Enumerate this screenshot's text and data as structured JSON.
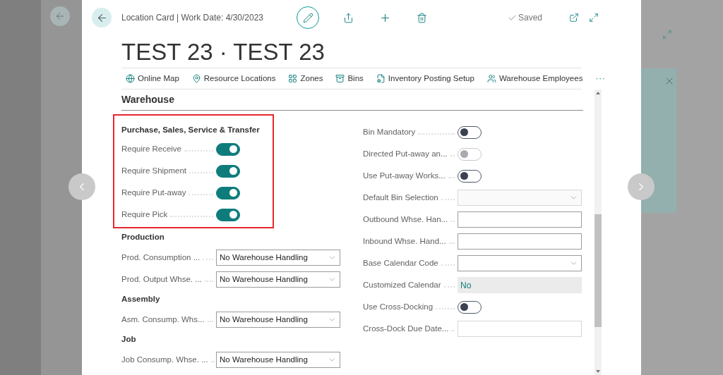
{
  "header": {
    "breadcrumb": "Location Card | Work Date: 4/30/2023",
    "status": "Saved",
    "title": "TEST 23 · TEST 23"
  },
  "actions": [
    {
      "label": "Online Map",
      "kind": "action"
    },
    {
      "label": "Resource Locations",
      "kind": "action"
    },
    {
      "label": "Zones",
      "kind": "action"
    },
    {
      "label": "Bins",
      "kind": "action"
    },
    {
      "label": "Inventory Posting Setup",
      "kind": "action"
    },
    {
      "label": "Warehouse Employees",
      "kind": "action"
    },
    {
      "label": "···",
      "kind": "more"
    }
  ],
  "section": {
    "title": "Warehouse"
  },
  "left_column": [
    {
      "title": "Purchase, Sales, Service & Transfer",
      "highlighted": true,
      "fields": [
        {
          "kind": "toggle",
          "label": "Require Receive",
          "on": true
        },
        {
          "kind": "toggle",
          "label": "Require Shipment",
          "on": true
        },
        {
          "kind": "toggle",
          "label": "Require Put-away",
          "on": true
        },
        {
          "kind": "toggle",
          "label": "Require Pick",
          "on": true
        }
      ]
    },
    {
      "title": "Production",
      "fields": [
        {
          "kind": "select",
          "label": "Prod. Consumption ...",
          "value": "No Warehouse Handling",
          "disabled": false
        },
        {
          "kind": "select",
          "label": "Prod. Output Whse. ...",
          "value": "No Warehouse Handling",
          "disabled": false
        }
      ]
    },
    {
      "title": "Assembly",
      "fields": [
        {
          "kind": "select",
          "label": "Asm. Consump. Whs...",
          "value": "No Warehouse Handling",
          "disabled": false
        }
      ]
    },
    {
      "title": "Job",
      "fields": [
        {
          "kind": "select",
          "label": "Job Consump. Whse. ...",
          "value": "No Warehouse Handling",
          "disabled": false
        }
      ]
    }
  ],
  "right_column": [
    {
      "kind": "toggle",
      "label": "Bin Mandatory",
      "on": false,
      "disabled": false
    },
    {
      "kind": "toggle",
      "label": "Directed Put-away an...",
      "on": false,
      "disabled": true
    },
    {
      "kind": "toggle",
      "label": "Use Put-away Works...",
      "on": false,
      "disabled": false
    },
    {
      "kind": "select",
      "label": "Default Bin Selection",
      "disabled": true
    },
    {
      "kind": "input",
      "label": "Outbound Whse. Han...",
      "disabled": false
    },
    {
      "kind": "input",
      "label": "Inbound Whse. Hand...",
      "disabled": false
    },
    {
      "kind": "select",
      "label": "Base Calendar Code",
      "disabled": false
    },
    {
      "kind": "readonly",
      "label": "Customized Calendar",
      "value": "No"
    },
    {
      "kind": "toggle",
      "label": "Use Cross-Docking",
      "on": false,
      "disabled": false
    },
    {
      "kind": "input",
      "label": "Cross-Dock Due Date...",
      "disabled": true
    }
  ]
}
